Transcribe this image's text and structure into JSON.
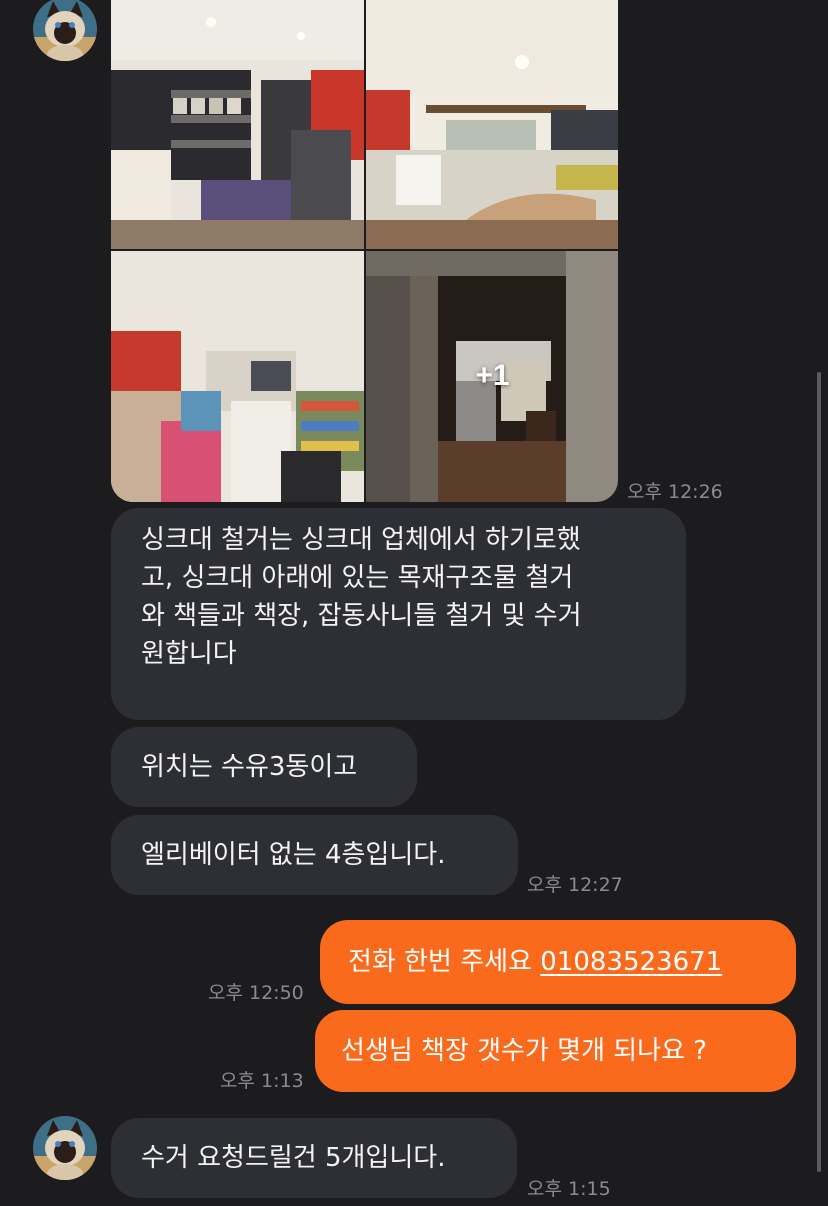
{
  "photo_album": {
    "more_count": "+1",
    "timestamp": "오후 12:26"
  },
  "messages": [
    {
      "direction": "received",
      "lines": [
        "싱크대 철거는 싱크대 업체에서 하기로했",
        "고, 싱크대 아래에 있는 목재구조물 철거",
        "와 책들과 책장, 잡동사니들 철거 및 수거",
        "원합니다"
      ]
    },
    {
      "direction": "received",
      "text": "위치는 수유3동이고"
    },
    {
      "direction": "received",
      "text": "엘리베이터 없는 4층입니다.",
      "timestamp": "오후 12:27"
    },
    {
      "direction": "sent",
      "text": "전화 한번 주세요 ",
      "phone": "01083523671",
      "timestamp": "오후 12:50"
    },
    {
      "direction": "sent",
      "text": "선생님  책장 갯수가 몇개 되나요 ?",
      "timestamp": "오후 1:13"
    },
    {
      "direction": "received",
      "text": "수거 요청드릴건 5개입니다.",
      "timestamp": "오후 1:15"
    }
  ],
  "colors": {
    "background": "#1c1c1f",
    "received_bubble": "#2e2f34",
    "sent_bubble": "#f96a1c",
    "timestamp": "#8a8b90"
  },
  "icons": {
    "avatar": "siamese-cat-avatar-icon"
  }
}
